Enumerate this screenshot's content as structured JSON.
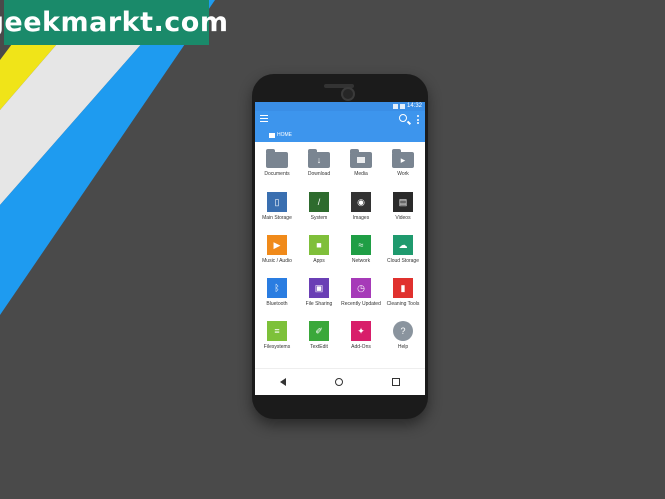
{
  "watermark": {
    "text": "geekmarkt.com"
  },
  "status_bar": {
    "time": "14:32"
  },
  "breadcrumb": {
    "label": "HOME"
  },
  "colors": {
    "background": "#4a4a4a",
    "appbar": "#3d95ed",
    "stripe_blue": "#1e9bf0",
    "stripe_light": "#e6e6e6",
    "stripe_yellow": "#f0e418"
  },
  "items": [
    {
      "label": "Documents",
      "icon": "folder-icon",
      "color": "#7a8591"
    },
    {
      "label": "Download",
      "icon": "download-folder-icon",
      "color": "#7a8591"
    },
    {
      "label": "Media",
      "icon": "media-folder-icon",
      "color": "#7a8591"
    },
    {
      "label": "Work",
      "icon": "work-folder-icon",
      "color": "#7a8591"
    },
    {
      "label": "Main Storage",
      "icon": "phone-storage-icon",
      "color": "#3a6fb0"
    },
    {
      "label": "System",
      "icon": "system-icon",
      "color": "#2e6b2e"
    },
    {
      "label": "Images",
      "icon": "camera-icon",
      "color": "#333333"
    },
    {
      "label": "Videos",
      "icon": "clapperboard-icon",
      "color": "#2a2a2a"
    },
    {
      "label": "Music / Audio",
      "icon": "music-icon",
      "color": "#f08a1a"
    },
    {
      "label": "Apps",
      "icon": "android-icon",
      "color": "#7fbf3a"
    },
    {
      "label": "Network",
      "icon": "wifi-icon",
      "color": "#1f9e45"
    },
    {
      "label": "Cloud Storage",
      "icon": "cloud-icon",
      "color": "#1f9a6e"
    },
    {
      "label": "Bluetooth",
      "icon": "bluetooth-icon",
      "color": "#2a7de1"
    },
    {
      "label": "File Sharing",
      "icon": "file-sharing-icon",
      "color": "#6a3fb5"
    },
    {
      "label": "Recently Updated",
      "icon": "clock-icon",
      "color": "#a63ab8"
    },
    {
      "label": "Cleaning Tools",
      "icon": "trash-icon",
      "color": "#e0312e"
    },
    {
      "label": "Filesystems",
      "icon": "filesystems-icon",
      "color": "#7dc13a"
    },
    {
      "label": "TextEdit",
      "icon": "text-edit-icon",
      "color": "#3aa83a"
    },
    {
      "label": "Add-Ons",
      "icon": "puzzle-icon",
      "color": "#d81e6a"
    },
    {
      "label": "Help",
      "icon": "help-icon",
      "color": "#8a949e"
    }
  ]
}
